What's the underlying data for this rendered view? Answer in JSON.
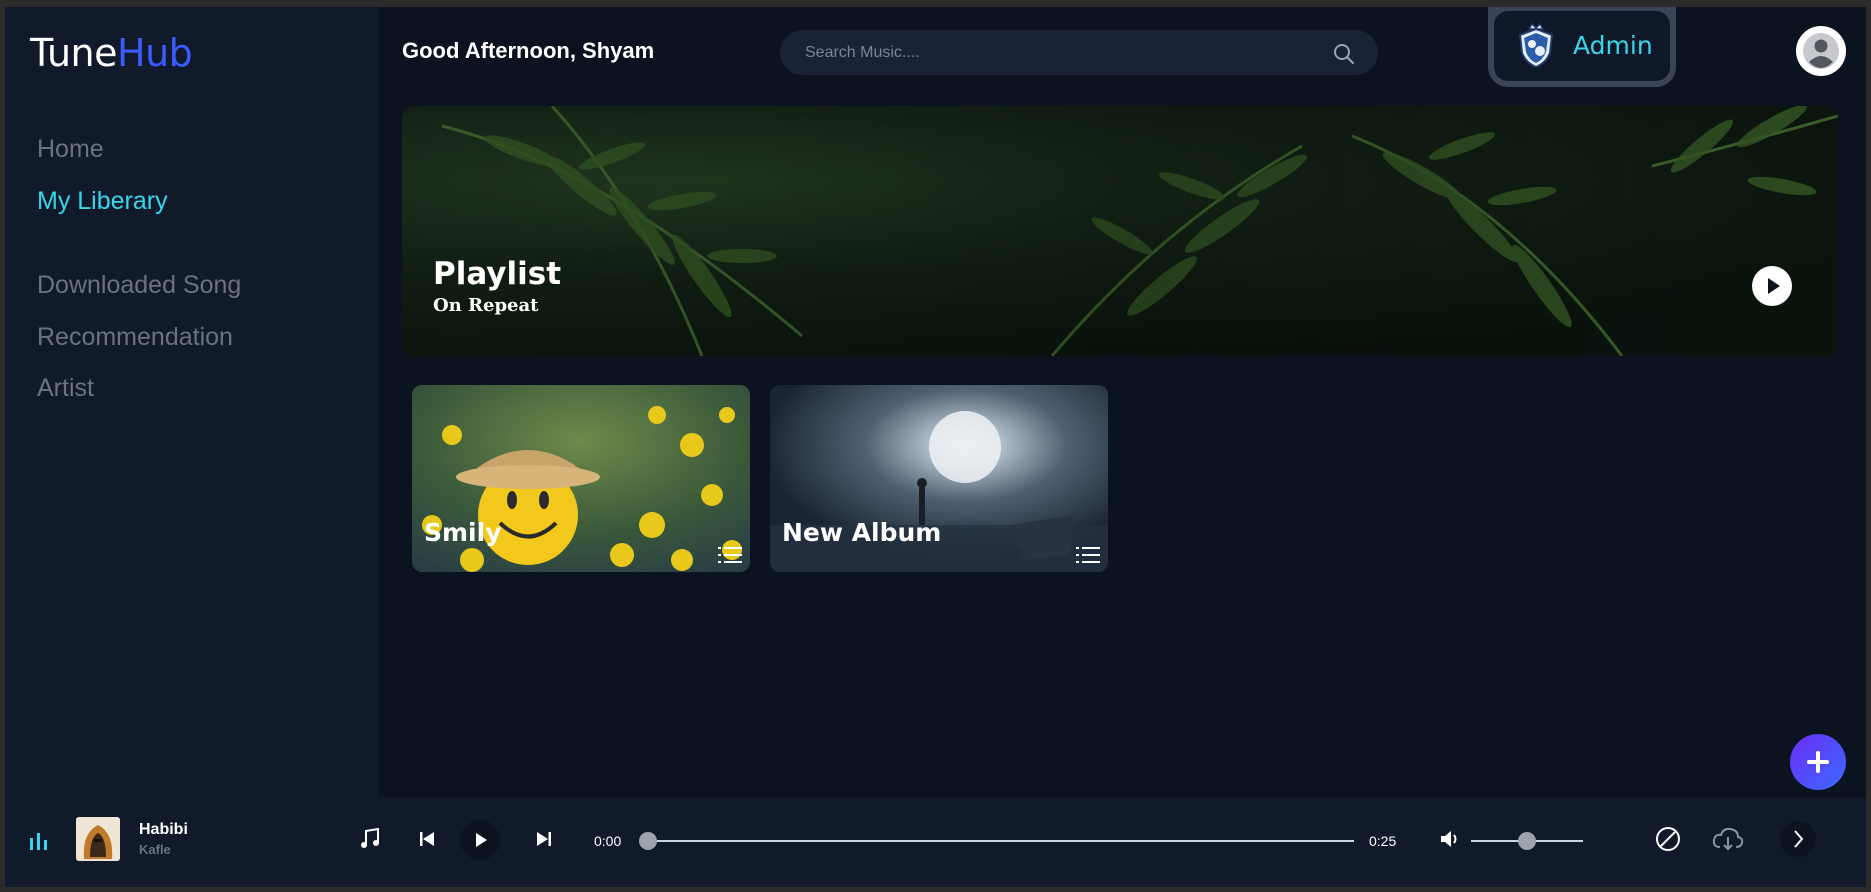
{
  "app": {
    "logo_part1": "Tune",
    "logo_part2": "Hub"
  },
  "sidebar": {
    "items": [
      {
        "label": "Home",
        "active": false
      },
      {
        "label": "My Liberary",
        "active": true
      },
      {
        "label": "Downloaded Song",
        "active": false
      },
      {
        "label": "Recommendation",
        "active": false
      },
      {
        "label": "Artist",
        "active": false
      }
    ]
  },
  "header": {
    "greeting": "Good Afternoon, Shyam",
    "search_placeholder": "Search Music....",
    "admin_label": "Admin"
  },
  "banner": {
    "title": "Playlist",
    "subtitle": "On Repeat"
  },
  "albums": [
    {
      "name": "Smily"
    },
    {
      "name": "New Album"
    }
  ],
  "player": {
    "song_title": "Habibi",
    "song_artist": "Kafle",
    "current_time": "0:00",
    "duration": "0:25",
    "progress": 0.0,
    "volume": 0.5
  },
  "colors": {
    "accent": "#38d6e8",
    "brand_blue": "#3b5bff",
    "background": "#0b1220",
    "sidebar": "#101a2b"
  },
  "icons": {
    "search": "search-icon",
    "admin": "admin-shield-icon",
    "avatar": "user-avatar-icon",
    "play": "play-icon",
    "list": "list-icon",
    "add": "plus-icon",
    "equalizer": "equalizer-icon",
    "music": "music-note-icon",
    "prev": "skip-previous-icon",
    "next": "skip-next-icon",
    "volume": "volume-icon",
    "block": "block-icon",
    "download": "cloud-download-icon",
    "chevron": "chevron-right-icon"
  }
}
